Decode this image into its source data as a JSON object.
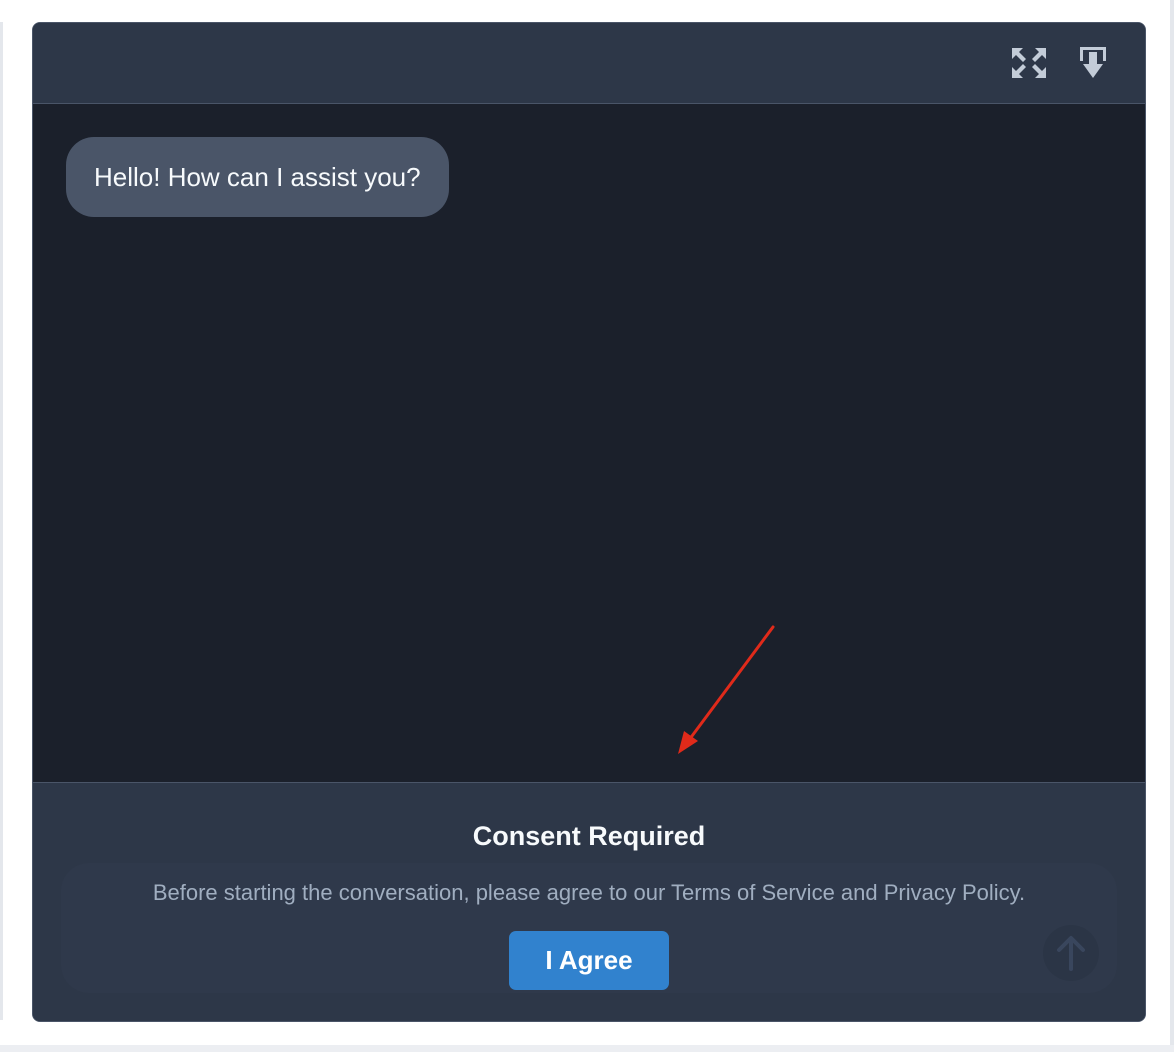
{
  "header": {
    "expand_icon": "expand-arrows-icon",
    "download_icon": "download-icon"
  },
  "messages": [
    {
      "role": "assistant",
      "text": "Hello! How can I assist you?"
    }
  ],
  "consent": {
    "title": "Consent Required",
    "text": "Before starting the conversation, please agree to our Terms of Service and Privacy Policy.",
    "button_label": "I Agree"
  },
  "composer": {
    "send_icon": "arrow-up-icon"
  },
  "annotation": {
    "type": "arrow",
    "color": "#e02a1a"
  },
  "colors": {
    "header_bg": "#2d3748",
    "message_area_bg": "#1b202b",
    "bubble_bg": "#4a5568",
    "button_bg": "#3182ce"
  }
}
